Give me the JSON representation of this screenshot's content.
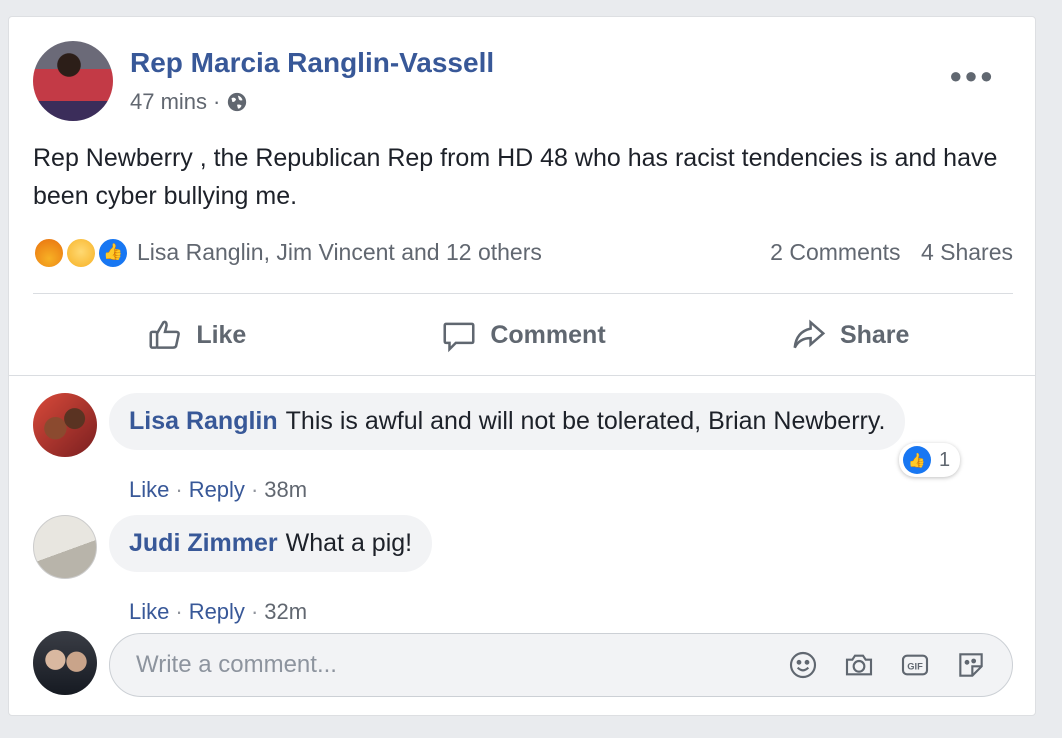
{
  "post": {
    "author": "Rep Marcia Ranglin-Vassell",
    "time": "47 mins",
    "privacy_sep": "·",
    "text": "Rep Newberry , the Republican Rep from HD 48 who has racist tendencies is and have been cyber bullying me.",
    "reaction_names": "Lisa Ranglin, Jim Vincent and 12 others",
    "reactions": [
      "angry",
      "wow",
      "like"
    ],
    "comments_count": "2 Comments",
    "shares_count": "4 Shares"
  },
  "actions": {
    "like": "Like",
    "comment": "Comment",
    "share": "Share"
  },
  "comments": [
    {
      "author": "Lisa Ranglin",
      "text": "This is awful and will not be tolerated, Brian Newberry.",
      "like": "Like",
      "reply": "Reply",
      "time": "38m",
      "reaction_count": "1"
    },
    {
      "author": "Judi Zimmer",
      "text": "What a pig!",
      "like": "Like",
      "reply": "Reply",
      "time": "32m"
    }
  ],
  "composer": {
    "placeholder": "Write a comment...",
    "icons": [
      "emoji-icon",
      "camera-icon",
      "gif-icon",
      "sticker-icon"
    ]
  },
  "colors": {
    "link": "#385898",
    "like_blue": "#1877f2",
    "muted": "#616770"
  }
}
